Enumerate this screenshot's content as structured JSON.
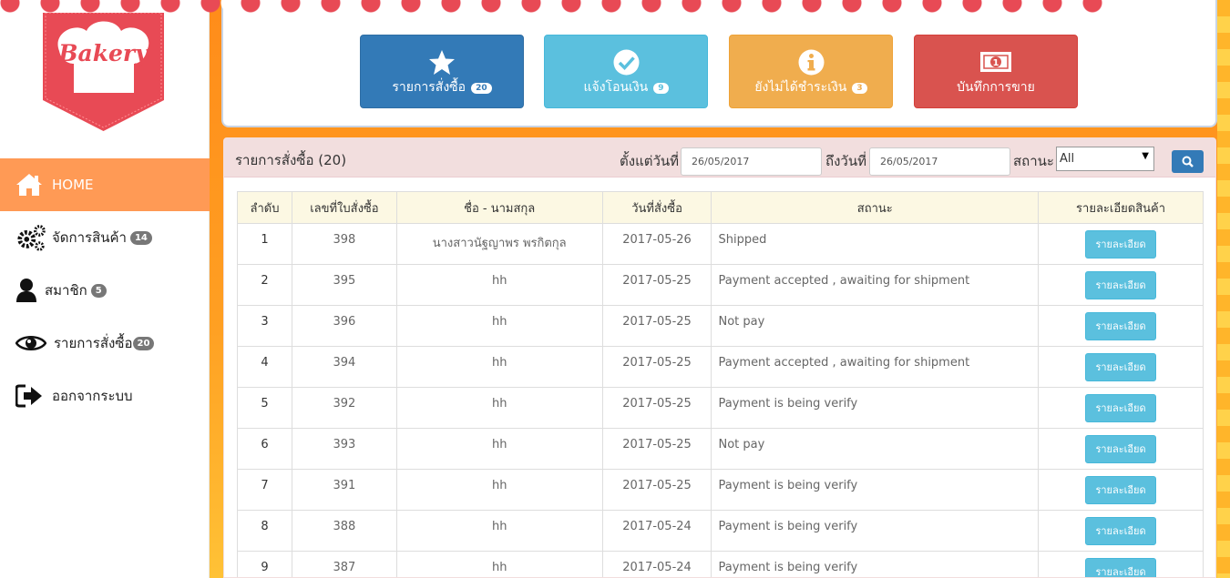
{
  "brand": {
    "logo_text": "Bakery"
  },
  "colors": {
    "background": "#ff9a22",
    "awning_red": "#e84a55",
    "primary": "#337ab7",
    "info": "#5bc0de",
    "warning": "#f0ad4e",
    "danger": "#d9534f",
    "nav_active": "#ff9a55"
  },
  "sidebar": {
    "items": [
      {
        "icon": "home-icon",
        "label": "HOME",
        "badge": "",
        "active": true
      },
      {
        "icon": "gears-icon",
        "label": "จัดการสินค้า",
        "badge": "14"
      },
      {
        "icon": "user-icon",
        "label": "สมาชิก",
        "badge": "5"
      },
      {
        "icon": "eye-icon",
        "label": "รายการสั่งซื้อ",
        "badge": "20"
      },
      {
        "icon": "sign-out-icon",
        "label": "ออกจากระบบ",
        "badge": ""
      }
    ]
  },
  "dashboard": {
    "buttons": [
      {
        "icon": "star-icon",
        "label": "รายการสั่งซื้อ",
        "badge": "20",
        "color": "#337ab7"
      },
      {
        "icon": "check-circle-icon",
        "label": "แจ้งโอนเงิน",
        "badge": "9",
        "color": "#5bc0de"
      },
      {
        "icon": "info-circle-icon",
        "label": "ยังไม่ได้ชำระเงิน",
        "badge": "3",
        "color": "#f0ad4e"
      },
      {
        "icon": "money-icon",
        "label": "บันทึกการขาย",
        "badge": "",
        "color": "#d9534f"
      }
    ]
  },
  "orders": {
    "title": "รายการสั่งซื้อ (20)",
    "filter": {
      "from_label": "ตั้งแต่วันที่",
      "from_value": "26/05/2017",
      "to_label": "ถึงวันที่",
      "to_value": "26/05/2017",
      "status_label": "สถานะ",
      "status_value": "All"
    },
    "columns": [
      "ลำดับ",
      "เลขที่ใบสั่งซื้อ",
      "ชื่อ - นามสกุล",
      "วันที่สั่งซื้อ",
      "สถานะ",
      "รายละเอียดสินค้า"
    ],
    "rows": [
      {
        "no": "1",
        "order_id": "398",
        "name": "นางสาวนัฐญาพร พรกิตกุล",
        "date": "2017-05-26",
        "status": "Shipped",
        "status_type": "shipped"
      },
      {
        "no": "2",
        "order_id": "395",
        "name": "hh",
        "date": "2017-05-25",
        "status": "Payment accepted , awaiting for shipment",
        "status_type": "accepted"
      },
      {
        "no": "3",
        "order_id": "396",
        "name": "hh",
        "date": "2017-05-25",
        "status": "Not pay",
        "status_type": "notpay"
      },
      {
        "no": "4",
        "order_id": "394",
        "name": "hh",
        "date": "2017-05-25",
        "status": "Payment accepted , awaiting for shipment",
        "status_type": "accepted"
      },
      {
        "no": "5",
        "order_id": "392",
        "name": "hh",
        "date": "2017-05-25",
        "status": "Payment is being verify",
        "status_type": "verify"
      },
      {
        "no": "6",
        "order_id": "393",
        "name": "hh",
        "date": "2017-05-25",
        "status": "Not pay",
        "status_type": "notpay"
      },
      {
        "no": "7",
        "order_id": "391",
        "name": "hh",
        "date": "2017-05-25",
        "status": "Payment is being verify",
        "status_type": "verify"
      },
      {
        "no": "8",
        "order_id": "388",
        "name": "hh",
        "date": "2017-05-24",
        "status": "Payment is being verify",
        "status_type": "verify"
      },
      {
        "no": "9",
        "order_id": "387",
        "name": "hh",
        "date": "2017-05-24",
        "status": "Payment is being verify",
        "status_type": "verify"
      }
    ],
    "detail_button_label": "รายละเอียด"
  }
}
